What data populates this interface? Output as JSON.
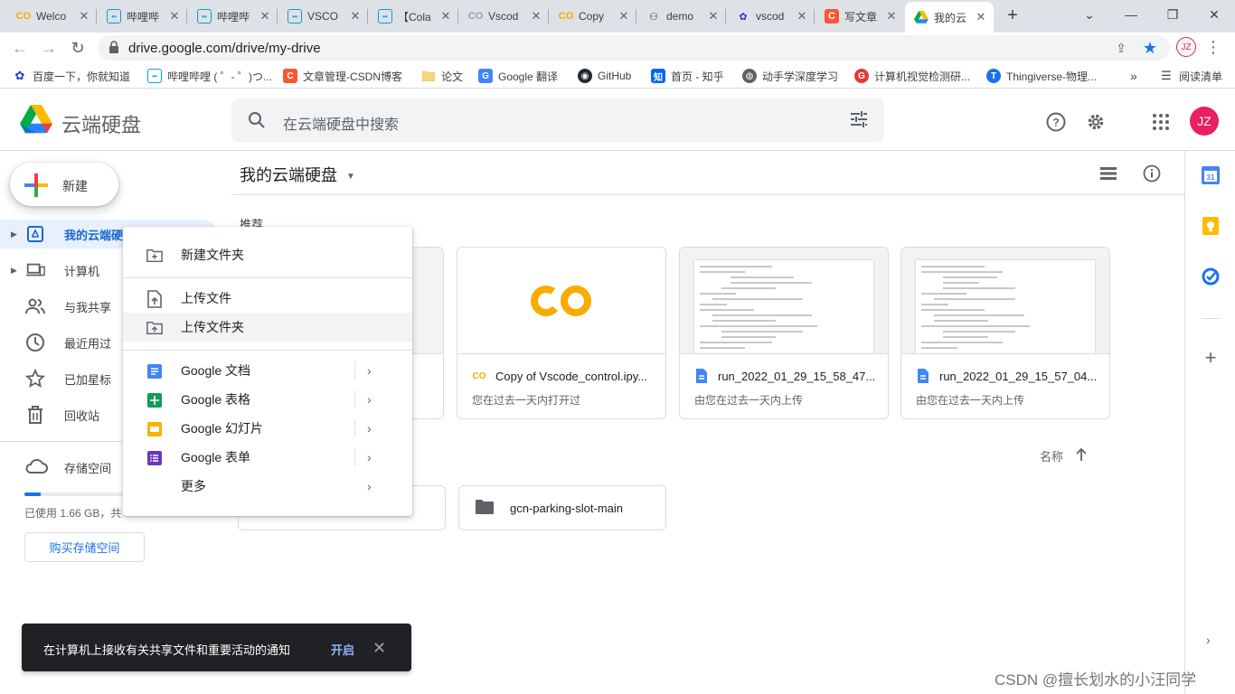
{
  "browser": {
    "tabs": [
      {
        "title": "Welco",
        "icon": "colab-icon"
      },
      {
        "title": "哔哩哔",
        "icon": "bilibili-icon"
      },
      {
        "title": "哔哩哔",
        "icon": "bilibili-icon"
      },
      {
        "title": "VSCO",
        "icon": "bilibili-icon"
      },
      {
        "title": "【Cola",
        "icon": "bilibili-icon"
      },
      {
        "title": "Vscod",
        "icon": "colab-gray-icon"
      },
      {
        "title": "Copy",
        "icon": "colab-icon"
      },
      {
        "title": "demo",
        "icon": "github-icon"
      },
      {
        "title": "vscod",
        "icon": "baidu-icon"
      },
      {
        "title": "写文章",
        "icon": "csdn-icon"
      },
      {
        "title": "我的云",
        "icon": "google-drive-icon"
      }
    ],
    "url": "drive.google.com/drive/my-drive",
    "profile_initials": "JZ",
    "bookmarks": [
      {
        "label": "百度一下，你就知道",
        "icon": "baidu-icon"
      },
      {
        "label": "哔哩哔哩 ( ゜- ゜)つ...",
        "icon": "bilibili-icon"
      },
      {
        "label": "文章管理-CSDN博客",
        "icon": "csdn-icon"
      },
      {
        "label": "论文",
        "icon": "folder-icon"
      },
      {
        "label": "Google 翻译",
        "icon": "translate-icon"
      },
      {
        "label": "GitHub",
        "icon": "github-icon"
      },
      {
        "label": "首页 - 知乎",
        "icon": "zhihu-icon"
      },
      {
        "label": "动手学深度学习",
        "icon": "globe-icon"
      },
      {
        "label": "计算机视觉检测研...",
        "icon": "g-icon"
      },
      {
        "label": "Thingiverse-物理...",
        "icon": "thingiverse-icon"
      }
    ],
    "bookmarks_more": "»",
    "reading_list": "阅读清单"
  },
  "header": {
    "brand": "云端硬盘",
    "search_placeholder": "在云端硬盘中搜索",
    "avatar_initials": "JZ"
  },
  "sidebar": {
    "new_label": "新建",
    "items": [
      {
        "label": "我的云端硬",
        "icon": "my-drive-icon",
        "arrow": true
      },
      {
        "label": "计算机",
        "icon": "computer-icon",
        "arrow": true
      },
      {
        "label": "与我共享",
        "icon": "shared-icon",
        "arrow": false
      },
      {
        "label": "最近用过",
        "icon": "recent-icon",
        "arrow": false
      },
      {
        "label": "已加星标",
        "icon": "star-icon",
        "arrow": false
      },
      {
        "label": "回收站",
        "icon": "trash-icon",
        "arrow": false
      }
    ],
    "storage_label": "存储空间",
    "storage_used_fraction": 0.15,
    "storage_text": "已使用 1.66 GB，共",
    "buy_label": "购买存储空间"
  },
  "main": {
    "title": "我的云端硬盘",
    "suggested_label": "推荐",
    "cards": [
      {
        "title": "",
        "subtitle": "",
        "kind": "image"
      },
      {
        "title": "Copy of Vscode_control.ipy...",
        "subtitle": "您在过去一天内打开过",
        "kind": "colab"
      },
      {
        "title": "run_2022_01_29_15_58_47...",
        "subtitle": "由您在过去一天内上传",
        "kind": "doc"
      },
      {
        "title": "run_2022_01_29_15_57_04...",
        "subtitle": "由您在过去一天内上传",
        "kind": "doc"
      }
    ],
    "sort_label": "名称",
    "folders": [
      {
        "label": ""
      },
      {
        "label": "gcn-parking-slot-main"
      }
    ]
  },
  "context_menu": {
    "items": [
      {
        "label": "新建文件夹",
        "icon": "new-folder-icon",
        "submenu": false
      },
      {
        "label": "上传文件",
        "icon": "upload-file-icon",
        "submenu": false
      },
      {
        "label": "上传文件夹",
        "icon": "upload-folder-icon",
        "submenu": false,
        "hover": true
      },
      {
        "label": "Google 文档",
        "icon": "google-docs-icon",
        "submenu": true
      },
      {
        "label": "Google 表格",
        "icon": "google-sheets-icon",
        "submenu": true
      },
      {
        "label": "Google 幻灯片",
        "icon": "google-slides-icon",
        "submenu": true
      },
      {
        "label": "Google 表单",
        "icon": "google-forms-icon",
        "submenu": true
      },
      {
        "label": "更多",
        "icon": "",
        "submenu": true
      }
    ]
  },
  "snackbar": {
    "text": "在计算机上接收有关共享文件和重要活动的通知",
    "action": "开启"
  },
  "watermark": "CSDN @擅长划水的小汪同学"
}
